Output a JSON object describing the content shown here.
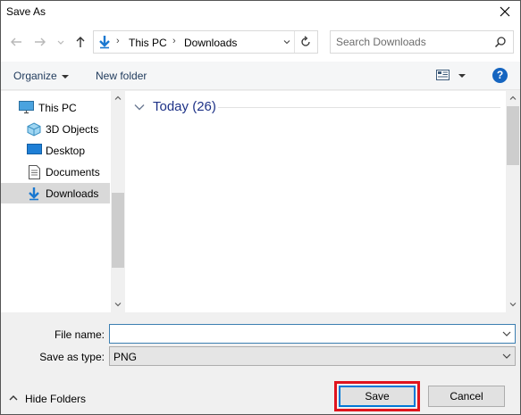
{
  "window": {
    "title": "Save As"
  },
  "address": {
    "crumbs": [
      "This PC",
      "Downloads"
    ]
  },
  "search": {
    "placeholder": "Search Downloads"
  },
  "toolbar": {
    "organize": "Organize",
    "new_folder": "New folder",
    "help": "?"
  },
  "tree": {
    "items": [
      {
        "label": "This PC",
        "icon": "pc-icon"
      },
      {
        "label": "3D Objects",
        "icon": "3d-objects-icon"
      },
      {
        "label": "Desktop",
        "icon": "desktop-icon"
      },
      {
        "label": "Documents",
        "icon": "documents-icon"
      },
      {
        "label": "Downloads",
        "icon": "downloads-icon",
        "selected": true
      }
    ]
  },
  "content": {
    "group_label": "Today (26)"
  },
  "form": {
    "file_name_label": "File name:",
    "file_name_value": "",
    "save_type_label": "Save as type:",
    "save_type_value": "PNG"
  },
  "footer": {
    "hide_folders": "Hide Folders",
    "save": "Save",
    "cancel": "Cancel"
  },
  "colors": {
    "accent": "#0078d7",
    "highlight": "#e0141e",
    "selection": "#d9d9d9"
  }
}
